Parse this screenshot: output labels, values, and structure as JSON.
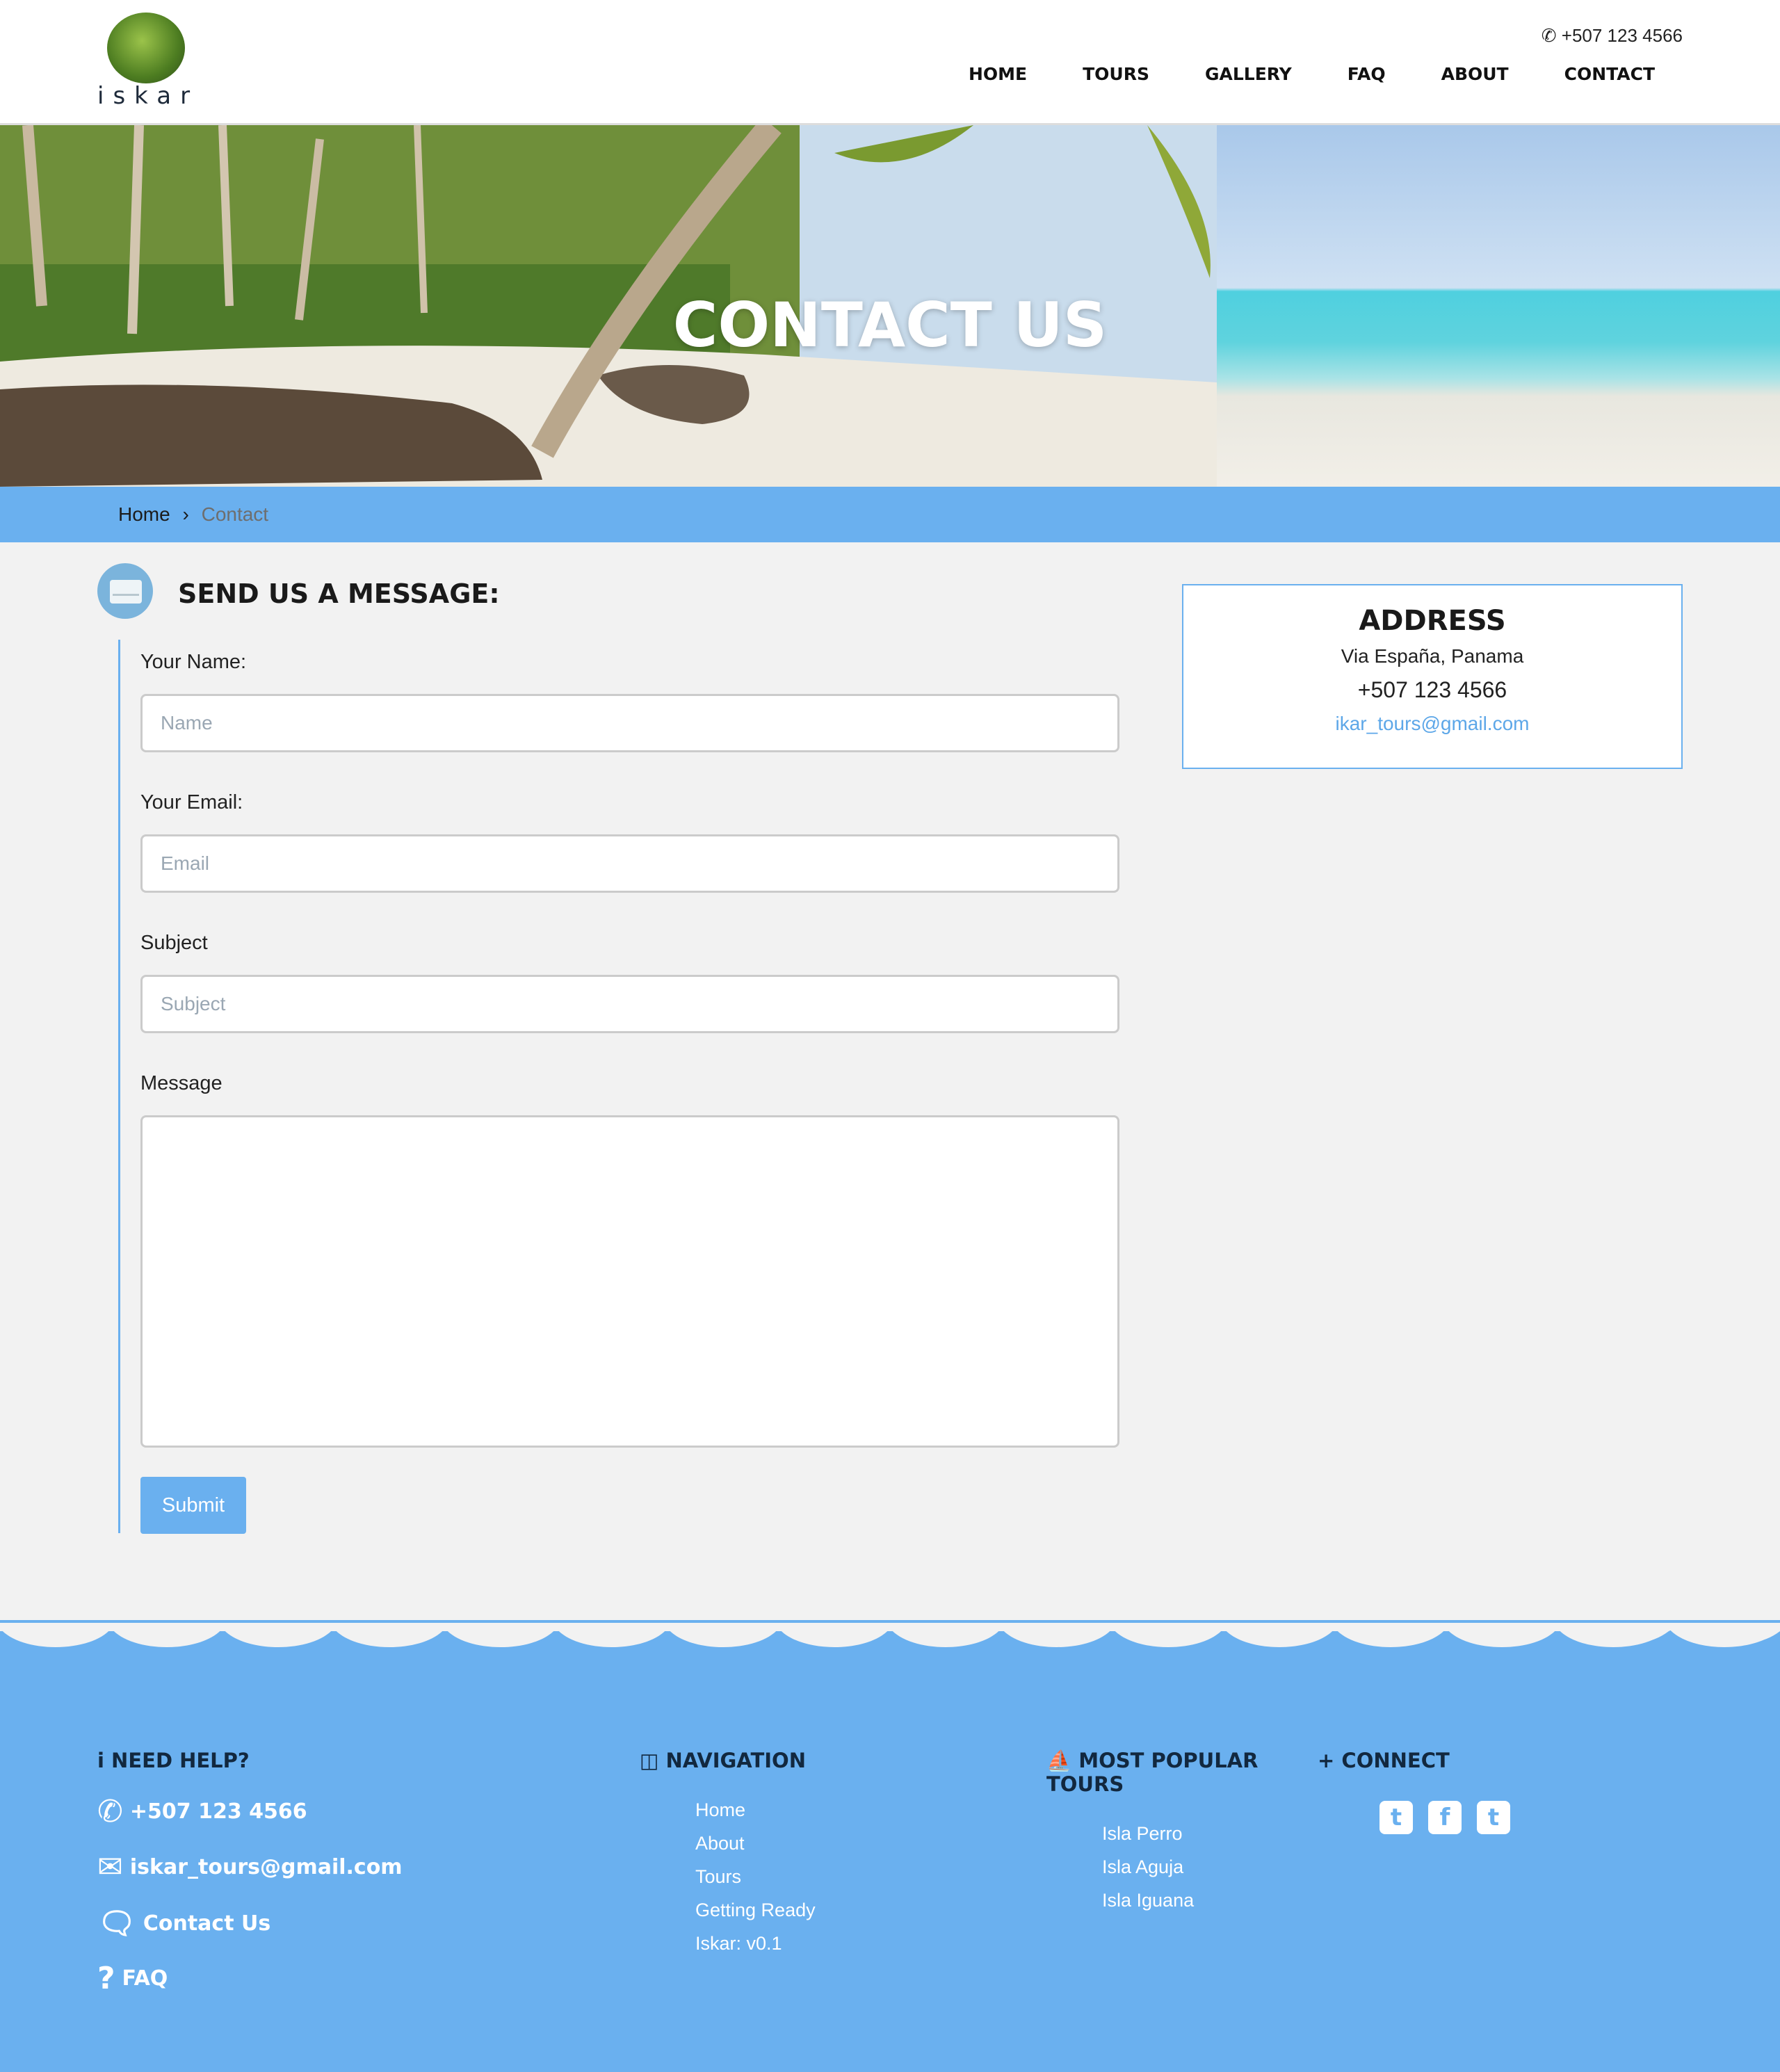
{
  "header": {
    "logo_text": "iskar",
    "phone": "+507 123 4566",
    "nav": [
      "HOME",
      "TOURS",
      "GALLERY",
      "FAQ",
      "ABOUT",
      "CONTACT"
    ]
  },
  "hero": {
    "title": "CONTACT US"
  },
  "breadcrumb": {
    "home": "Home",
    "separator": "›",
    "current": "Contact"
  },
  "form": {
    "title": "SEND US A MESSAGE:",
    "name_label": "Your Name:",
    "name_placeholder": "Name",
    "email_label": "Your Email:",
    "email_placeholder": "Email",
    "subject_label": "Subject",
    "subject_placeholder": "Subject",
    "message_label": "Message",
    "submit_label": "Submit"
  },
  "address": {
    "title": "ADDRESS",
    "street": "Via España, Panama",
    "phone": "+507 123 4566",
    "email": "ikar_tours@gmail.com"
  },
  "footer": {
    "help": {
      "title": "NEED HELP?",
      "phone": "+507 123 4566",
      "email": "iskar_tours@gmail.com",
      "contact": "Contact Us",
      "faq": "FAQ"
    },
    "navigation": {
      "title": "NAVIGATION",
      "items": [
        "Home",
        "About",
        "Tours",
        "Getting Ready",
        "Iskar: v0.1"
      ]
    },
    "popular": {
      "title_line1": "MOST POPULAR",
      "title_line2": "TOURS",
      "items": [
        "Isla Perro",
        "Isla Aguja",
        "Isla Iguana"
      ]
    },
    "connect": {
      "title": "CONNECT"
    }
  },
  "colors": {
    "accent": "#6ab0ef",
    "background": "#f2f2f2",
    "dark_text": "#12283f"
  }
}
